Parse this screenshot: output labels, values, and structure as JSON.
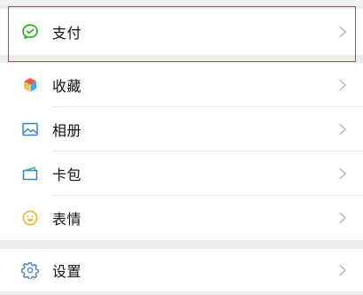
{
  "menu": {
    "pay": {
      "label": "支付",
      "icon": "wechat-pay-icon"
    },
    "favorites": {
      "label": "收藏",
      "icon": "cube-icon"
    },
    "album": {
      "label": "相册",
      "icon": "image-icon"
    },
    "cards": {
      "label": "卡包",
      "icon": "card-icon"
    },
    "stickers": {
      "label": "表情",
      "icon": "smiley-icon"
    },
    "settings": {
      "label": "设置",
      "icon": "gear-icon"
    }
  },
  "colors": {
    "pay_green": "#1aad19",
    "highlight_red": "#d9393a",
    "chevron": "#b2b2b2"
  }
}
